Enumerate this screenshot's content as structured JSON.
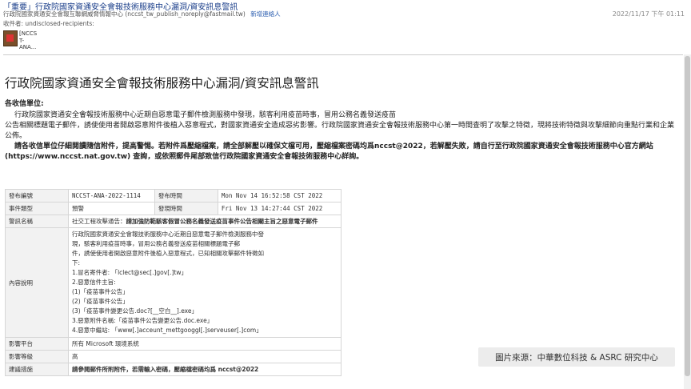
{
  "email": {
    "subject": "「重要」行政院國家資通安全會報技術服務中心漏洞/資安訊息警訊",
    "from": "行政院國家資通安全會報互聯網威脅情報中心 (nccst_tw_publish_noreply@fastmail.tw)",
    "add_contact": "新增連絡人",
    "date": "2022/11/17 下午 01:11",
    "to": "收件者: undisclosed-recipients:",
    "attachment_name": "[NCCS\nT-\nANA..."
  },
  "content": {
    "title": "行政院國家資通安全會報技術服務中心漏洞/資安訊息警訊",
    "recipient_label": "各收信單位:",
    "para1": "行政院國家資通安全會報技術服務中心近期自惡意電子郵件檢測服務中發現，駭客利用疫苗時事，冒用公務名義發送疫苗",
    "para2": "公告相關標題電子郵件，誘使使用者開啟惡意附件後植入惡意程式，對國家資通安全造成惡劣影響。行政院國家資通安全會報技術服務中心第一時間查明了攻擊之特徵，現將技術特徵與攻擊細節向重點行業和企業公佈。",
    "para3_bold": "請各收信單位仔細閱讀隨信附件，提高警惕。若附件爲壓縮檔案，請全部解壓以確保文檔可用，壓縮檔案密碼均爲nccst@2022，若解壓失敗，請自行至行政院國家資通安全會報技術服務中心官方網站(https://www.nccst.nat.gov.tw) 查詢，或依照郵件尾部致信行政院國家資通安全會報技術服務中心詳詢。"
  },
  "table": {
    "row1": {
      "k1": "發布編號",
      "v1": "NCCST-ANA-2022-1114",
      "k2": "發布時間",
      "v2": "Mon Nov 14 16:52:58 CST 2022"
    },
    "row2": {
      "k1": "事件類型",
      "v1": "預警",
      "k2": "發現時間",
      "v2": "Fri Nov 13 14:27:44 CST 2022"
    },
    "row3": {
      "k": "警訊名稱",
      "v_plain": "社交工程攻擊通告：",
      "v_bold": "請加強防範駭客假冒公務名義發送疫苗事件公告相關主旨之惡意電子郵件"
    },
    "row4": {
      "k": "內容說明",
      "lines": [
        "行政院國家資通安全會報技術服務中心近期自惡意電子郵件檢測服務中發",
        "現，駭客利用疫苗時事，冒用公務名義發送疫苗相關標題電子郵",
        "件，誘使使用者開啟惡意附件後植入惡意程式，已知相關攻擊郵件特徵如",
        "下:",
        "1.冒名寄件者: 「lclect@sec[.]gov[.]tw」",
        "2.惡意信件主旨:",
        "(1)「疫苗事件公告」",
        "(2)「疫苗事件公告」",
        "(3)「疫苗事件變更公告.doc?[__空白__].exe」",
        "3.惡意附件名稱:「疫苗事件公告變更公告.doc.exe」",
        "4.惡意中繼站: 「www[.]acceunt_mettgooggl[.]serveuser[.]com」"
      ]
    },
    "row5": {
      "k": "影響平台",
      "v": "所有 Microsoft 環境系統"
    },
    "row6": {
      "k": "影響等級",
      "v": "高"
    },
    "row7": {
      "k": "建議措施",
      "v": "請參閱郵件所附附件，若需輸入密碼，壓縮檔密碼均爲 nccst@2022"
    }
  },
  "image_source": "圖片來源：中華數位科技 & ASRC 研究中心"
}
